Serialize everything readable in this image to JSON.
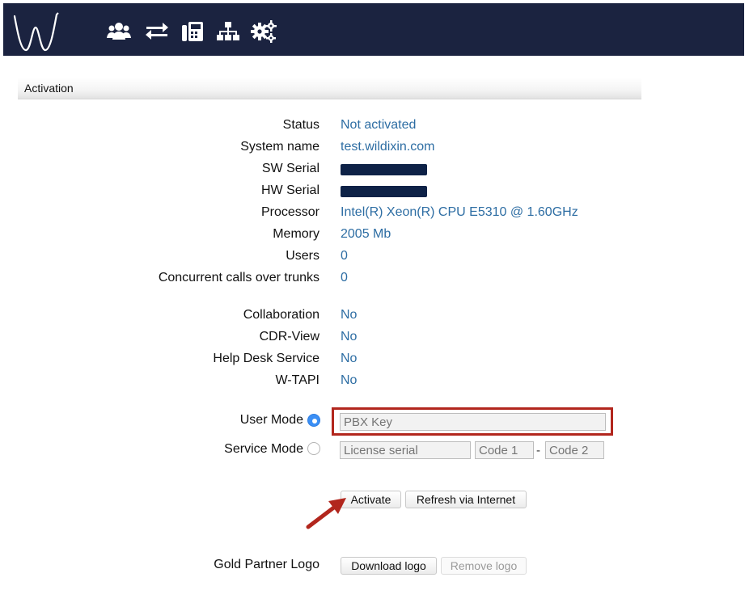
{
  "nav": {
    "icons": [
      "users-icon",
      "transfer-icon",
      "fax-icon",
      "org-chart-icon",
      "gears-icon"
    ]
  },
  "section": {
    "title": "Activation"
  },
  "info": {
    "status_label": "Status",
    "status_value": "Not activated",
    "system_name_label": "System name",
    "system_name_value": "test.wildixin.com",
    "sw_serial_label": "SW Serial",
    "hw_serial_label": "HW Serial",
    "processor_label": "Processor",
    "processor_value": "Intel(R) Xeon(R) CPU E5310 @ 1.60GHz",
    "memory_label": "Memory",
    "memory_value": "2005 Mb",
    "users_label": "Users",
    "users_value": "0",
    "calls_label": "Concurrent calls over trunks",
    "calls_value": "0"
  },
  "features": {
    "collaboration_label": "Collaboration",
    "collaboration_value": "No",
    "cdr_label": "CDR-View",
    "cdr_value": "No",
    "helpdesk_label": "Help Desk Service",
    "helpdesk_value": "No",
    "wtapi_label": "W-TAPI",
    "wtapi_value": "No"
  },
  "mode": {
    "user_label": "User Mode",
    "service_label": "Service Mode",
    "pbx_key_placeholder": "PBX Key",
    "license_placeholder": "License serial",
    "code1_placeholder": "Code 1",
    "code2_placeholder": "Code 2",
    "dash": "-"
  },
  "actions": {
    "activate": "Activate",
    "refresh": "Refresh via Internet"
  },
  "logo": {
    "label": "Gold Partner Logo",
    "download": "Download logo",
    "remove": "Remove logo"
  },
  "colors": {
    "header_bg": "#1b2340",
    "value_text": "#2d6da3",
    "highlight": "#b2261d"
  }
}
